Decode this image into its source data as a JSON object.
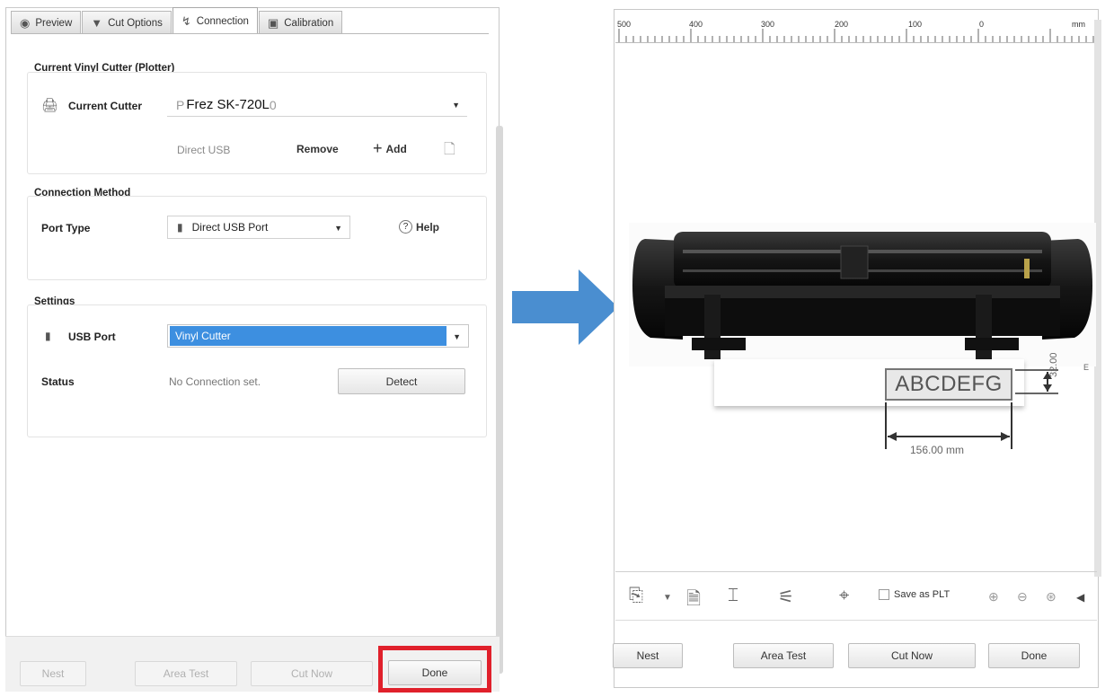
{
  "left": {
    "tabs": [
      {
        "label": "Preview",
        "icon": "eye-icon"
      },
      {
        "label": "Cut Options",
        "icon": "blade-icon"
      },
      {
        "label": "Connection",
        "icon": "connection-icon"
      },
      {
        "label": "Calibration",
        "icon": "calibration-icon"
      }
    ],
    "current_cutter": {
      "section_title": "Current Vinyl Cutter (Plotter)",
      "label": "Current Cutter",
      "ghost_value": "P",
      "value": "Frez SK-720L",
      "ghost_suffix": "0",
      "connection_note": "Direct USB",
      "remove_label": "Remove",
      "add_label": "Add",
      "add_symbol": "+"
    },
    "connection_method": {
      "section_title": "Connection Method",
      "port_type_label": "Port Type",
      "port_type_value": "Direct USB Port",
      "help_label": "Help",
      "help_symbol": "?"
    },
    "settings": {
      "section_title": "Settings",
      "usb_port_label": "USB Port",
      "usb_port_value": "Vinyl Cutter",
      "status_label": "Status",
      "status_value": "No Connection set.",
      "detect_label": "Detect"
    },
    "buttons": {
      "nest": "Nest",
      "area_test": "Area Test",
      "cut_now": "Cut Now",
      "done": "Done"
    },
    "highlight_color": "#e0202b"
  },
  "right": {
    "ruler": {
      "ticks": [
        "500",
        "400",
        "300",
        "200",
        "100",
        "0"
      ],
      "unit": "mm"
    },
    "preview_text": "ABCDEFG",
    "width_dimension": "156.00 mm",
    "height_dimension": "32.00",
    "height_unit": "E",
    "save_plt_label": "Save as PLT",
    "buttons": {
      "nest": "Nest",
      "area_test": "Area Test",
      "cut_now": "Cut Now",
      "done": "Done"
    }
  },
  "arrow_color": "#4a8ed0"
}
